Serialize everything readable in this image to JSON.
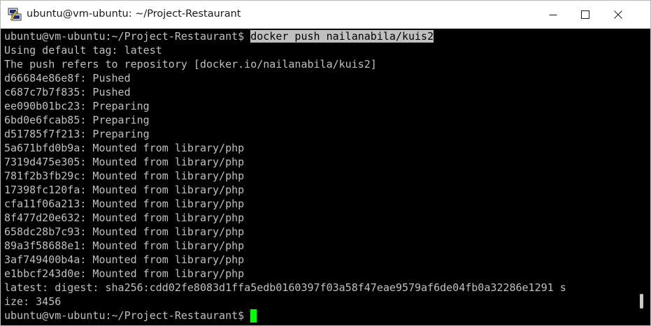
{
  "window": {
    "title": "ubuntu@vm-ubuntu: ~/Project-Restaurant",
    "icon": "putty-terminal-icon",
    "controls": {
      "minimize": "minimize-icon",
      "maximize": "maximize-icon",
      "close": "close-icon"
    }
  },
  "terminal": {
    "prompt": "ubuntu@vm-ubuntu:~/Project-Restaurant$ ",
    "command": "docker push nailanabila/kuis2",
    "output": [
      "Using default tag: latest",
      "The push refers to repository [docker.io/nailanabila/kuis2]",
      "d66684e86e8f: Pushed",
      "c687c7b7f835: Pushed",
      "ee090b01bc23: Preparing",
      "6bd0e6fcab85: Preparing",
      "d51785f7f213: Preparing",
      "5a671bfd0b9a: Mounted from library/php",
      "7319d475e305: Mounted from library/php",
      "781f2b3fb29c: Mounted from library/php",
      "17398fc120fa: Mounted from library/php",
      "cfa11f06a213: Mounted from library/php",
      "8f477d20e632: Mounted from library/php",
      "658dc28b7c93: Mounted from library/php",
      "89a3f58688e1: Mounted from library/php",
      "3af749400b4a: Mounted from library/php",
      "e1bbcf243d0e: Mounted from library/php",
      "latest: digest: sha256:cdd02fe8083d1ffa5edb0160397f03a58f47eae9579af6de04fb0a32286e1291 s",
      "ize: 3456"
    ],
    "final_prompt": "ubuntu@vm-ubuntu:~/Project-Restaurant$ ",
    "colors": {
      "background": "#000000",
      "text": "#c0c0c0",
      "highlight_bg": "#c0c0c0",
      "cursor": "#00ff00"
    }
  }
}
